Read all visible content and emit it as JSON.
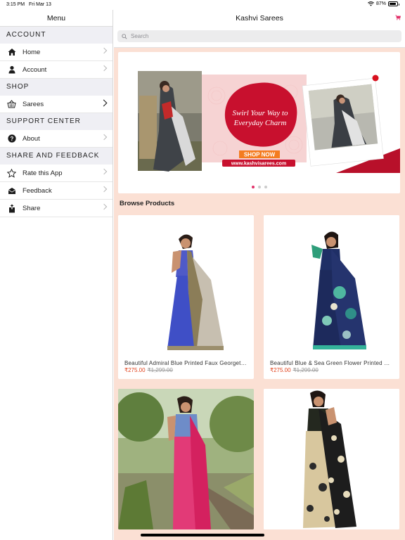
{
  "status": {
    "time": "3:15 PM",
    "date": "Fri Mar 13",
    "battery": "87%",
    "battery_level": 0.87
  },
  "sidebar": {
    "title": "Menu",
    "sections": [
      {
        "header": "ACCOUNT",
        "items": [
          {
            "label": "Home",
            "icon": "home-icon"
          },
          {
            "label": "Account",
            "icon": "person-icon"
          }
        ]
      },
      {
        "header": "SHOP",
        "items": [
          {
            "label": "Sarees",
            "icon": "basket-icon"
          }
        ]
      },
      {
        "header": "SUPPORT CENTER",
        "items": [
          {
            "label": "About",
            "icon": "question-icon"
          }
        ]
      },
      {
        "header": "SHARE AND FEEDBACK",
        "items": [
          {
            "label": "Rate this App",
            "icon": "star-icon"
          },
          {
            "label": "Feedback",
            "icon": "envelope-icon"
          },
          {
            "label": "Share",
            "icon": "share-icon"
          }
        ]
      }
    ]
  },
  "main": {
    "title": "Kashvi Sarees",
    "search_placeholder": "Search",
    "banner": {
      "headline_line1": "Swirl Your Way to",
      "headline_line2": "Everyday Charm",
      "cta": "SHOP NOW",
      "url": "www.kashvisarees.com",
      "page_count": 3,
      "active_page": 1
    },
    "browse_title": "Browse Products",
    "products": [
      {
        "name": "Beautiful Admiral Blue Printed Faux Georgette Saree",
        "price": "₹275.00",
        "old_price": "₹1,299.00"
      },
      {
        "name": "Beautiful Blue & Sea Green Flower Printed Saree",
        "price": "₹275.00",
        "old_price": "₹1,299.00"
      },
      {
        "name": "",
        "price": "",
        "old_price": ""
      },
      {
        "name": "",
        "price": "",
        "old_price": ""
      }
    ]
  },
  "colors": {
    "accent": "#e2336b",
    "background": "#fbe0d4",
    "price": "#e2441e",
    "banner_red": "#c8102e",
    "cta_orange": "#f47c20"
  }
}
